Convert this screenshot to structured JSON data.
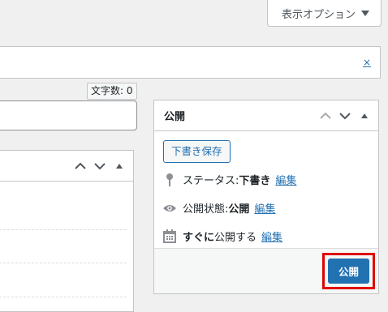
{
  "screen_options": {
    "label": "表示オプション"
  },
  "notice": {
    "dismiss": "×"
  },
  "editor": {
    "word_count": "文字数: 0"
  },
  "publish": {
    "title": "公開",
    "save_draft": "下書き保存",
    "status_label": "ステータス: ",
    "status_value": "下書き",
    "visibility_label": "公開状態: ",
    "visibility_value": "公開",
    "schedule_value": "すぐに",
    "schedule_label": "公開する",
    "edit": "編集",
    "publish_button": "公開"
  },
  "icons": {
    "up": "chevron-up-icon",
    "down": "chevron-down-icon",
    "toggle": "triangle-toggle-icon",
    "pin": "pin-icon",
    "eye": "eye-icon",
    "calendar": "calendar-icon"
  }
}
